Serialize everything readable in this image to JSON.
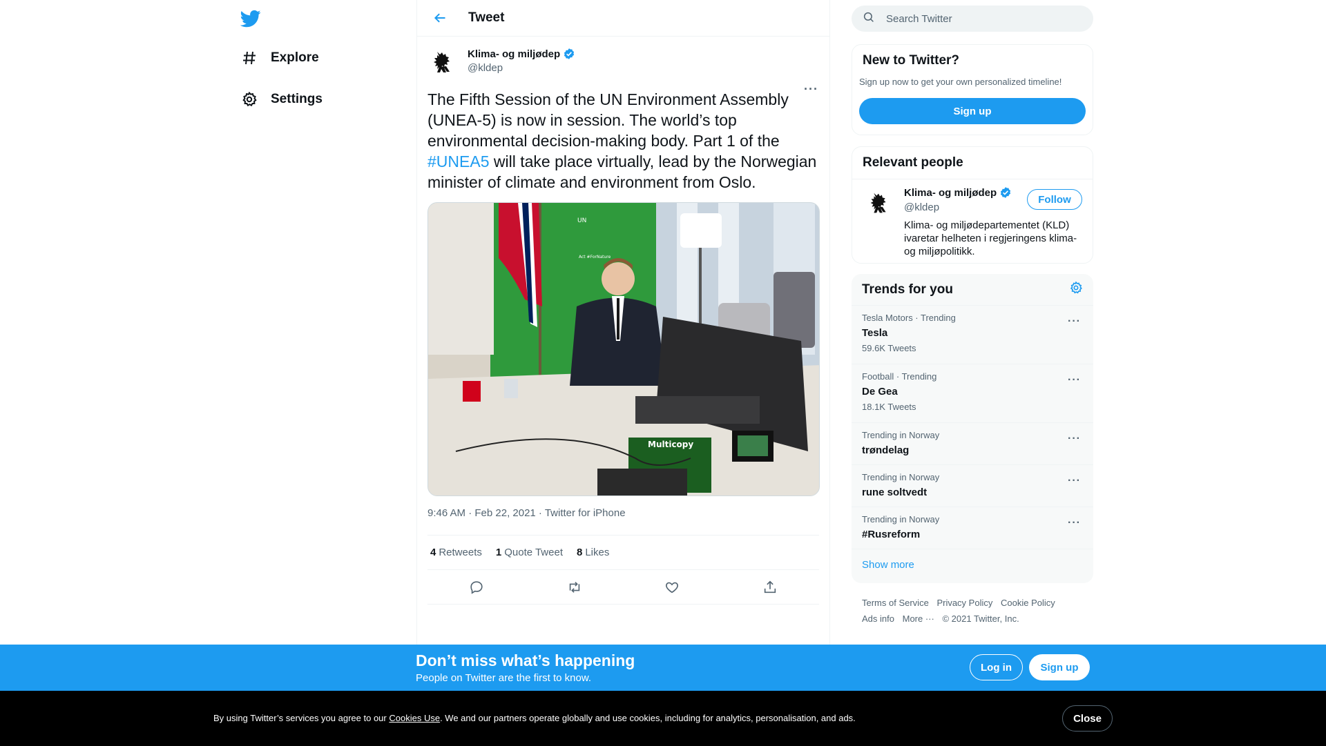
{
  "nav": {
    "logo_icon": "twitter-bird-icon",
    "items": [
      {
        "label": "Explore",
        "icon": "hashtag-icon"
      },
      {
        "label": "Settings",
        "icon": "gear-icon"
      }
    ]
  },
  "header": {
    "title": "Tweet"
  },
  "tweet": {
    "author_name": "Klima- og miljødep",
    "author_handle": "@kldep",
    "text_part1": "The Fifth Session of the UN Environment Assembly (UNEA-5) is now in session. The world’s top environmental decision-making body. Part 1 of the ",
    "hashtag": "#UNEA5",
    "text_part2": " will take place virtually, lead by the Norwegian minister of climate and environment from Oslo.",
    "meta": "9:46 AM · Feb 22, 2021 · Twitter for iPhone",
    "stats": {
      "retweets_count": "4",
      "retweets_label": "Retweets",
      "quotes_count": "1",
      "quotes_label": "Quote Tweet",
      "likes_count": "8",
      "likes_label": "Likes"
    },
    "photo_labels": [
      "UN",
      "Act #ForNature",
      "Multicopy"
    ]
  },
  "search": {
    "placeholder": "Search Twitter"
  },
  "new_to_twitter": {
    "title": "New to Twitter?",
    "subtitle": "Sign up now to get your own personalized timeline!",
    "button": "Sign up"
  },
  "relevant_people": {
    "title": "Relevant people",
    "name": "Klima- og miljødep",
    "handle": "@kldep",
    "follow": "Follow",
    "bio": "Klima- og miljødepartementet (KLD) ivaretar helheten i regjeringens klima- og miljøpolitikk."
  },
  "trends": {
    "title": "Trends for you",
    "items": [
      {
        "context": "Tesla Motors · Trending",
        "name": "Tesla",
        "count": "59.6K Tweets"
      },
      {
        "context": "Football · Trending",
        "name": "De Gea",
        "count": "18.1K Tweets"
      },
      {
        "context": "Trending in Norway",
        "name": "trøndelag",
        "count": ""
      },
      {
        "context": "Trending in Norway",
        "name": "rune soltvedt",
        "count": ""
      },
      {
        "context": "Trending in Norway",
        "name": "#Rusreform",
        "count": ""
      }
    ],
    "show_more": "Show more"
  },
  "footer": {
    "links": [
      "Terms of Service",
      "Privacy Policy",
      "Cookie Policy",
      "Ads info",
      "More ···",
      "© 2021 Twitter, Inc."
    ]
  },
  "banner": {
    "title": "Don’t miss what’s happening",
    "subtitle": "People on Twitter are the first to know.",
    "login": "Log in",
    "signup": "Sign up"
  },
  "cookie": {
    "text_before": "By using Twitter’s services you agree to our ",
    "link": "Cookies Use",
    "text_after": ". We and our partners operate globally and use cookies, including for analytics, personalisation, and ads.",
    "close": "Close"
  },
  "colors": {
    "accent": "#1d9bf0",
    "text": "#0f1419",
    "muted": "#536471",
    "banner": "#1d9bf0",
    "cookie_bg": "#000000"
  }
}
